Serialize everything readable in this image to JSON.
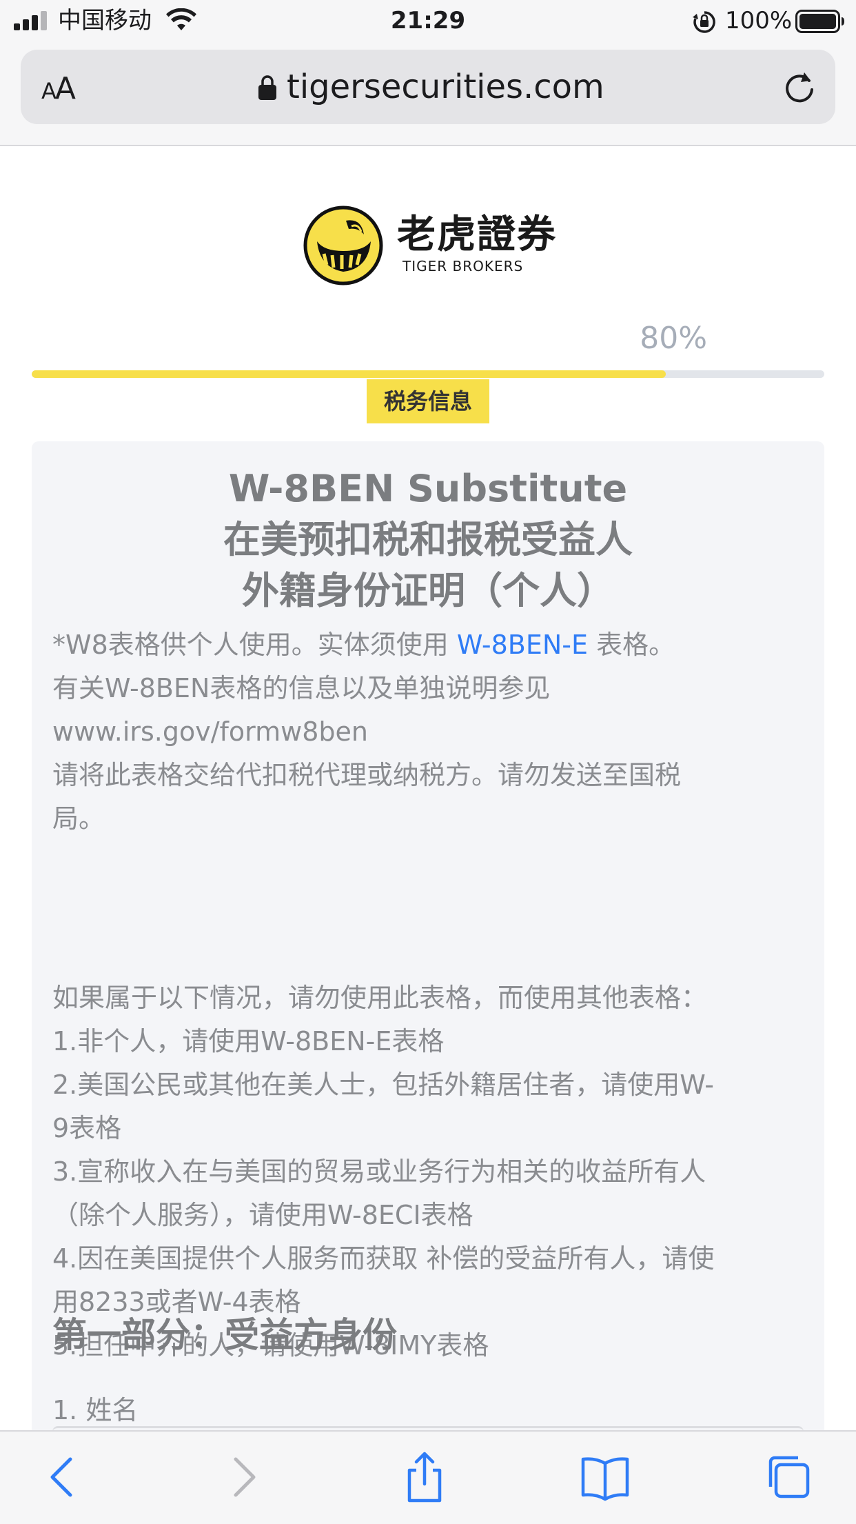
{
  "status_bar": {
    "carrier": "中国移动",
    "time": "21:29",
    "battery": "100%"
  },
  "browser": {
    "aa_label": "AA",
    "url": "tigersecurities.com"
  },
  "brand": {
    "name_cn": "老虎證券",
    "name_en": "TIGER BROKERS"
  },
  "progress": {
    "percent_label": "80%",
    "value": 0.8,
    "step_label": "税务信息"
  },
  "card": {
    "title_lines": [
      "W-8BEN Substitute",
      "在美预扣税和报税受益人",
      "外籍身份证明（个人）"
    ],
    "intro": {
      "line1_prefix": "*W8表格供个人使用。实体须使用 ",
      "line1_link": "W-8BEN-E",
      "line1_suffix": " 表格。",
      "line2": "有关W-8BEN表格的信息以及单独说明参见",
      "line3": "www.irs.gov/formw8ben",
      "line4": "请将此表格交给代扣税代理或纳税方。请勿发送至国税",
      "line5": "局。"
    },
    "conditions": [
      "如果属于以下情况，请勿使用此表格，而使用其他表格：",
      "1.非个人，请使用W-8BEN-E表格",
      "2.美国公民或其他在美人士，包括外籍居住者，请使用W-",
      "9表格",
      "3.宣称收入在与美国的贸易或业务行为相关的收益所有人",
      "（除个人服务），请使用W-8ECI表格",
      "4.因在美国提供个人服务而获取 补偿的受益所有人，请使",
      "用8233或者W-4表格",
      "5.担任中介的人，请使用W-8IMY表格"
    ],
    "section_heading": "第一部分：受益方身份",
    "field_label": "1. 姓名"
  },
  "colors": {
    "accent_yellow": "#f7df4a",
    "link_blue": "#2f7cf6",
    "ios_blue": "#2f7cf6"
  },
  "toolbar": {
    "icons": [
      "back-icon",
      "forward-icon",
      "share-icon",
      "bookmarks-icon",
      "tabs-icon"
    ]
  }
}
